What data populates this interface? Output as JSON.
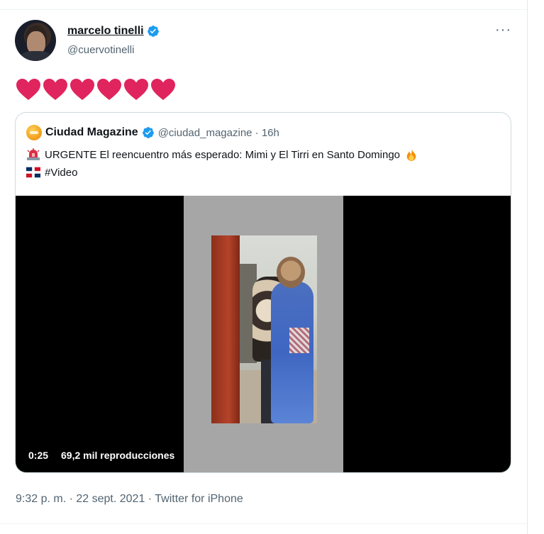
{
  "tweet": {
    "author": {
      "display_name": "marcelo tinelli",
      "handle": "@cuervotinelli",
      "verified": true,
      "avatar_icon": "profile-photo"
    },
    "more_label": "···",
    "hearts": [
      "red-heart",
      "red-heart",
      "red-heart",
      "red-heart",
      "red-heart",
      "red-heart"
    ],
    "timestamp": "9:32 p. m. · 22 sept. 2021 · Twitter for iPhone"
  },
  "quote": {
    "author": {
      "display_name": "Ciudad Magazine",
      "handle_time": "@ciudad_magazine · 16h",
      "verified": true,
      "avatar_icon": "ciudad-magazine-logo"
    },
    "line1": {
      "emoji": "rotating-light-icon",
      "text": "URGENTE El reencuentro más esperado: Mimi y El Tirri en Santo Domingo",
      "emoji_end": "fire-icon"
    },
    "line2": {
      "emoji": "dominican-flag-icon",
      "text": "#Video"
    },
    "video": {
      "duration": "0:25",
      "views": "69,2 mil reproducciones"
    }
  },
  "colors": {
    "text": "#0f1419",
    "muted": "#536471",
    "verified": "#1d9bf0",
    "heart": "#e0245e",
    "border": "#cfd9de"
  }
}
